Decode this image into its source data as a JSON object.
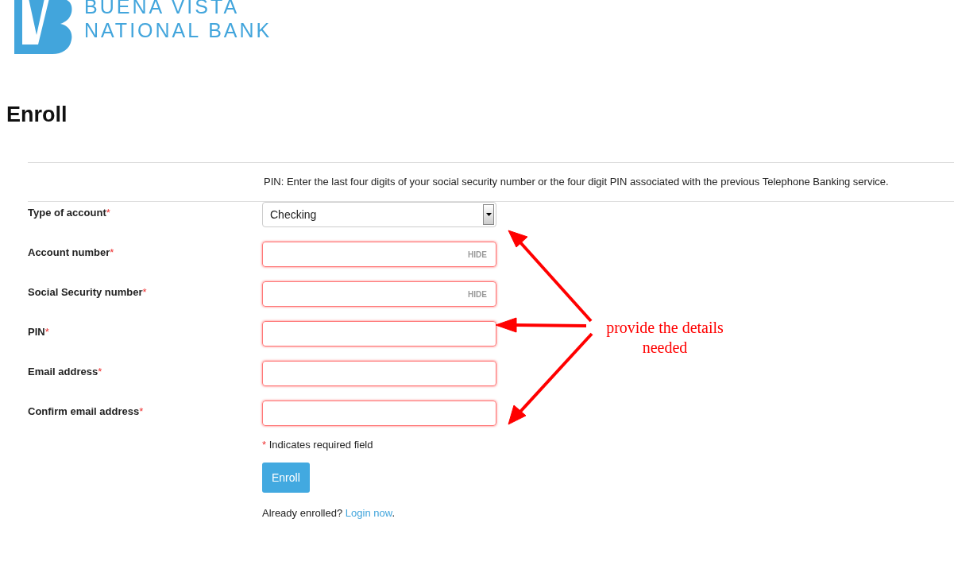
{
  "logo": {
    "line_1": "BUENA VISTA",
    "line_2": "NATIONAL BANK"
  },
  "heading": "Enroll",
  "pin_note": "PIN: Enter the last four digits of your social security number or the four digit PIN associated with the previous Telephone Banking service.",
  "fields": [
    {
      "kind": "select",
      "label": "Type of account",
      "required_mark": "*",
      "value": "Checking",
      "invalid": false
    },
    {
      "kind": "masked",
      "label": "Account number",
      "required_mark": "*",
      "toggle": "HIDE",
      "invalid": true
    },
    {
      "kind": "masked",
      "label": "Social Security number",
      "required_mark": "*",
      "toggle": "HIDE",
      "invalid": true
    },
    {
      "kind": "text",
      "label": "PIN",
      "required_mark": "*",
      "invalid": true
    },
    {
      "kind": "text",
      "label": "Email address",
      "required_mark": "*",
      "invalid": true
    },
    {
      "kind": "text",
      "label": "Confirm email address",
      "required_mark": "*",
      "invalid": true
    }
  ],
  "required_note": {
    "mark": "*",
    "text": "Indicates required field"
  },
  "submit_button": "Enroll",
  "login_prompt": {
    "text": "Already enrolled?",
    "link": "Login now",
    "end": "."
  },
  "annotation": {
    "text": "provide the details needed"
  }
}
